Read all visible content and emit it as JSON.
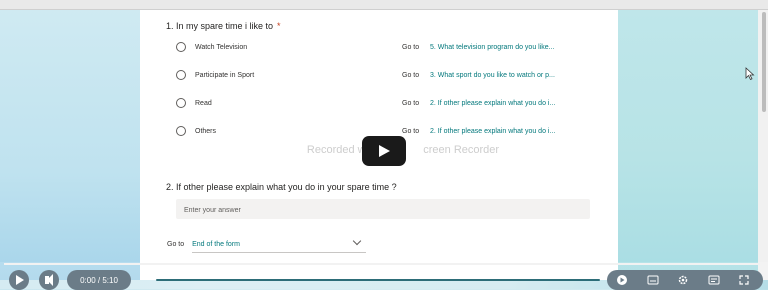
{
  "watermark": "Recorded with",
  "watermark_tail": "creen Recorder",
  "question1": {
    "number_title": "1. In my spare time i like to",
    "required_mark": "*",
    "options": [
      {
        "label": "Watch Television",
        "goto_label": "Go to",
        "goto_target": "5. What television program do you like..."
      },
      {
        "label": "Participate in Sport",
        "goto_label": "Go to",
        "goto_target": "3. What sport do you like to watch or p..."
      },
      {
        "label": "Read",
        "goto_label": "Go to",
        "goto_target": "2. If other please explain what you do i..."
      },
      {
        "label": "Others",
        "goto_label": "Go to",
        "goto_target": "2. If other please explain what you do i..."
      }
    ]
  },
  "question2": {
    "number_title": "2. If other please explain what you do in your spare time ?",
    "answer_placeholder": "Enter your answer",
    "goto_label": "Go to",
    "goto_selected": "End of the form"
  },
  "player": {
    "time": "0:00 / 5:10"
  },
  "colors": {
    "accent": "#03787c",
    "required": "#c43e1c",
    "player_bar": "#6b7c88"
  }
}
